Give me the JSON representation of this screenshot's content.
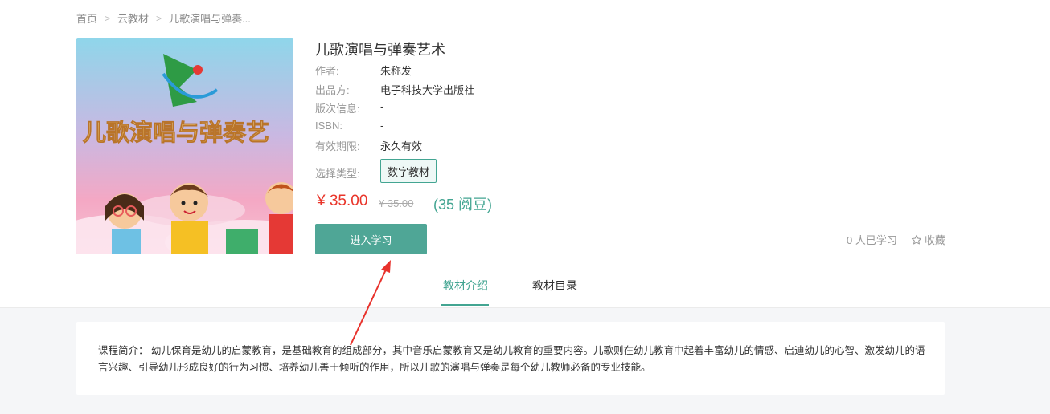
{
  "breadcrumb": [
    "首页",
    "云教材",
    "儿歌演唱与弹奏..."
  ],
  "book": {
    "title": "儿歌演唱与弹奏艺术",
    "cover_title": "儿歌演唱与弹奏艺",
    "info": [
      {
        "label": "作者:",
        "value": "朱称发"
      },
      {
        "label": "出品方:",
        "value": "电子科技大学出版社"
      },
      {
        "label": "版次信息:",
        "value": "-"
      },
      {
        "label": "ISBN:",
        "value": "-"
      },
      {
        "label": "有效期限:",
        "value": "永久有效"
      }
    ],
    "type_label": "选择类型:",
    "type_option": "数字教材",
    "price": "¥ 35.00",
    "old_price": "¥ 35.00",
    "beans": "(35 阅豆)",
    "enter_label": "进入学习",
    "learners": "0 人已学习",
    "favorite": "收藏"
  },
  "tabs": [
    {
      "label": "教材介绍",
      "active": true
    },
    {
      "label": "教材目录",
      "active": false
    }
  ],
  "intro": {
    "text": "课程简介： 幼儿保育是幼儿的启蒙教育，是基础教育的组成部分，其中音乐启蒙教育又是幼儿教育的重要内容。儿歌则在幼儿教育中起着丰富幼儿的情感、启迪幼儿的心智、激发幼儿的语言兴趣、引导幼儿形成良好的行为习惯、培养幼儿善于倾听的作用，所以儿歌的演唱与弹奏是每个幼儿教师必备的专业技能。"
  },
  "colors": {
    "accent": "#43a592",
    "button": "#4fa696",
    "price": "#e9352a",
    "annotation_arrow": "#e8322c"
  }
}
